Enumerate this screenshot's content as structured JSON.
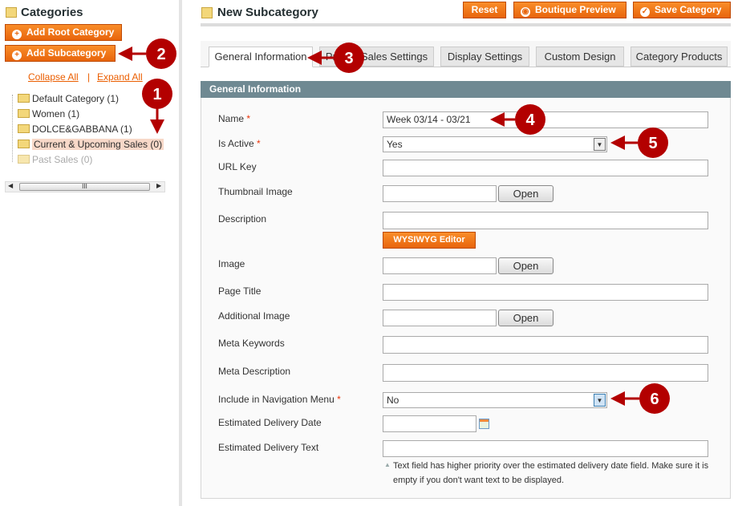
{
  "sidebar": {
    "title": "Categories",
    "add_root": "Add Root Category",
    "add_sub": "Add Subcategory",
    "collapse": "Collapse All",
    "sep": "|",
    "expand": "Expand All",
    "tree": [
      {
        "label": "Default Category (1)"
      },
      {
        "label": "Women (1)"
      },
      {
        "label": "DOLCE&GABBANA (1)"
      },
      {
        "label": "Current & Upcoming Sales (0)",
        "selected": true
      },
      {
        "label": "Past Sales (0)",
        "disabled": true
      }
    ],
    "scroll_grip": "III"
  },
  "header": {
    "title": "New Subcategory",
    "reset": "Reset",
    "preview": "Boutique Preview",
    "save": "Save Category"
  },
  "tabs": [
    "General Information",
    "Private Sales Settings",
    "Display Settings",
    "Custom Design",
    "Category Products"
  ],
  "section": {
    "title": "General Information"
  },
  "form": {
    "name": {
      "label": "Name",
      "value": "Week 03/14 - 03/21"
    },
    "is_active": {
      "label": "Is Active",
      "value": "Yes"
    },
    "url_key": {
      "label": "URL Key"
    },
    "thumbnail": {
      "label": "Thumbnail Image",
      "button": "Open"
    },
    "description": {
      "label": "Description",
      "button": "WYSIWYG Editor"
    },
    "image": {
      "label": "Image",
      "button": "Open"
    },
    "page_title": {
      "label": "Page Title"
    },
    "additional_image": {
      "label": "Additional Image",
      "button": "Open"
    },
    "meta_keywords": {
      "label": "Meta Keywords"
    },
    "meta_description": {
      "label": "Meta Description"
    },
    "include_nav": {
      "label": "Include in Navigation Menu",
      "value": "No"
    },
    "delivery_date": {
      "label": "Estimated Delivery Date"
    },
    "delivery_text": {
      "label": "Estimated Delivery Text",
      "note": "Text field has higher priority over the estimated delivery date field. Make sure it is empty if you don't want text to be displayed."
    },
    "required_mark": "*"
  },
  "markers": [
    "1",
    "2",
    "3",
    "4",
    "5",
    "6"
  ],
  "colors": {
    "accent": "#f18200",
    "marker": "#b30000",
    "section_header": "#6f8992"
  }
}
